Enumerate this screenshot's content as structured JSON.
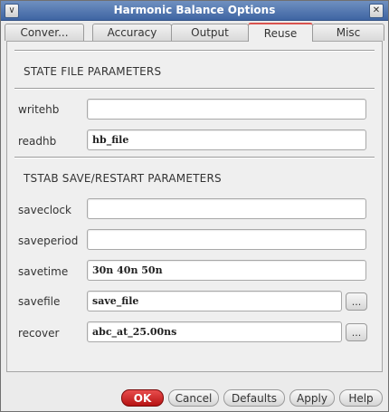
{
  "window": {
    "title": "Harmonic Balance Options",
    "menu_glyph": "∨",
    "close_glyph": "✕"
  },
  "tabs": [
    {
      "label": "Conver...",
      "active": false
    },
    {
      "label": "Accuracy",
      "active": false
    },
    {
      "label": "Output",
      "active": false
    },
    {
      "label": "Reuse",
      "active": true
    },
    {
      "label": "Misc",
      "active": false
    }
  ],
  "state_section": {
    "title": "STATE FILE PARAMETERS",
    "fields": [
      {
        "label": "writehb",
        "value": ""
      },
      {
        "label": "readhb",
        "value": "hb_file"
      }
    ]
  },
  "tstab_section": {
    "title": "TSTAB SAVE/RESTART PARAMETERS",
    "fields": [
      {
        "label": "saveclock",
        "value": ""
      },
      {
        "label": "saveperiod",
        "value": ""
      },
      {
        "label": "savetime",
        "value": "30n 40n 50n"
      },
      {
        "label": "savefile",
        "value": "save_file"
      },
      {
        "label": "recover",
        "value": "abc_at_25.00ns"
      }
    ]
  },
  "browse_label": "...",
  "buttons": {
    "ok": "OK",
    "cancel": "Cancel",
    "defaults": "Defaults",
    "apply": "Apply",
    "help": "Help"
  },
  "colors": {
    "titlebar": "#4f73ad",
    "ok_button": "#cc2222",
    "active_tab_accent": "#d9534f"
  }
}
